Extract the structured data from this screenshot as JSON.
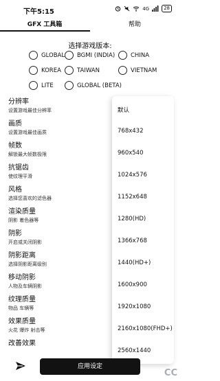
{
  "status_bar": {
    "time": "下午5:15",
    "icons": [
      "alarm-icon",
      "mute-icon",
      "wifi-icon",
      "signal-icon"
    ],
    "network": "4G",
    "battery": "28"
  },
  "tabs": [
    {
      "label": "GFX 工具箱",
      "active": true
    },
    {
      "label": "帮助",
      "active": false
    }
  ],
  "version": {
    "title": "选择游戏版本:",
    "options": [
      "GLOBAL",
      "BGMI (INDIA)",
      "CHINA",
      "KOREA",
      "TAIWAN",
      "VIETNAM",
      "LITE",
      "GLOBAL (BETA)"
    ]
  },
  "settings": [
    {
      "label": "分辨率",
      "desc": "设置游戏最佳分辨率"
    },
    {
      "label": "画质",
      "desc": "设置游戏最佳画质"
    },
    {
      "label": "帧数",
      "desc": "解锁最大帧数极限"
    },
    {
      "label": "抗锯齿",
      "desc": "使纹理平滑"
    },
    {
      "label": "风格",
      "desc": "选择您喜欢的滤色器"
    },
    {
      "label": "渲染质量",
      "desc": "阴影 着色器等"
    },
    {
      "label": "阴影",
      "desc": "开启或关闭阴影"
    },
    {
      "label": "阴影距离",
      "desc": "选择阴影距离级别"
    },
    {
      "label": "移动阴影",
      "desc": "人物及车辆阴影"
    },
    {
      "label": "纹理质量",
      "desc": "物品 车辆等"
    },
    {
      "label": "效果质量",
      "desc": "火花 爆炸 射击等"
    },
    {
      "label": "改善效果",
      "desc": ""
    }
  ],
  "resolution_dropdown": {
    "options": [
      "默认",
      "768x432",
      "960x540",
      "1024x576",
      "1152x648",
      "1280(HD)",
      "1366x768",
      "1440(HD+)",
      "1600x900",
      "1920x1080",
      "2160x1080(FHD+)",
      "2560x1440"
    ]
  },
  "bottom": {
    "apply_label": "应用设定",
    "send_icon": "send-icon"
  }
}
